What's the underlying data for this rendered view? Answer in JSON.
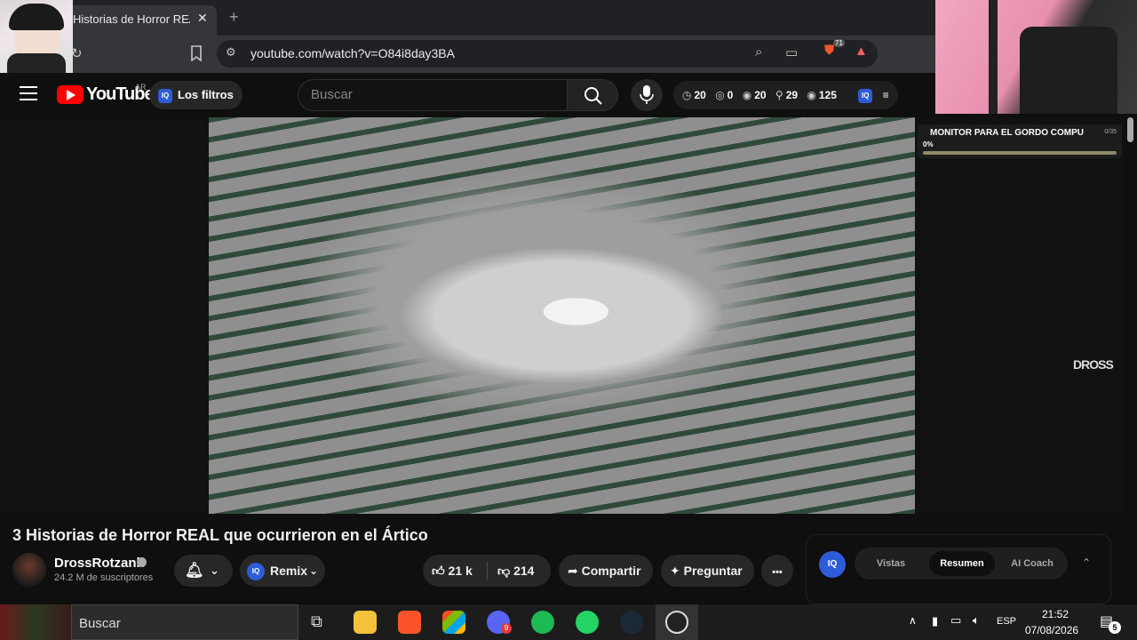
{
  "browser": {
    "tab_title": "Historias de Horror REAL",
    "tab_close": "✕",
    "new_tab": "+",
    "url": "youtube.com/watch?v=O84i8day3BA",
    "extension_badge": "71"
  },
  "header": {
    "logo_text": "YouTube",
    "country": "AR",
    "filters_label": "Los filtros",
    "search_placeholder": "Buscar",
    "stats": [
      {
        "icon": "clock-icon",
        "value": "20"
      },
      {
        "icon": "eye-off-icon",
        "value": "0"
      },
      {
        "icon": "eye-icon",
        "value": "20"
      },
      {
        "icon": "person-icon",
        "value": "29"
      },
      {
        "icon": "eye-icon",
        "value": "125"
      }
    ]
  },
  "overlay": {
    "monitor_title": "MONITOR PARA EL GORDO COMPU",
    "monitor_count": "0/35",
    "monitor_percent": "0%",
    "monitor_progress": 0
  },
  "video": {
    "watermark": "DROSS",
    "title": "3 Historias de Horror REAL que ocurrieron en el Ártico",
    "channel_name": "DrossRotzank",
    "subscribers": "24.2 M de suscriptores",
    "remix_label": "Remix",
    "likes": "21 k",
    "dislikes": "214",
    "share_label": "Compartir",
    "ask_label": "Preguntar",
    "more_label": "•••"
  },
  "iq_panel": {
    "logo": "IQ",
    "tabs": [
      "Vistas",
      "Resumen",
      "AI Coach"
    ],
    "active_tab": "Resumen"
  },
  "taskbar": {
    "search_label": "Buscar",
    "language": "ESP",
    "time": "21:52",
    "date": "07/08/2026",
    "notifications": "5",
    "discord_badge": "9"
  }
}
